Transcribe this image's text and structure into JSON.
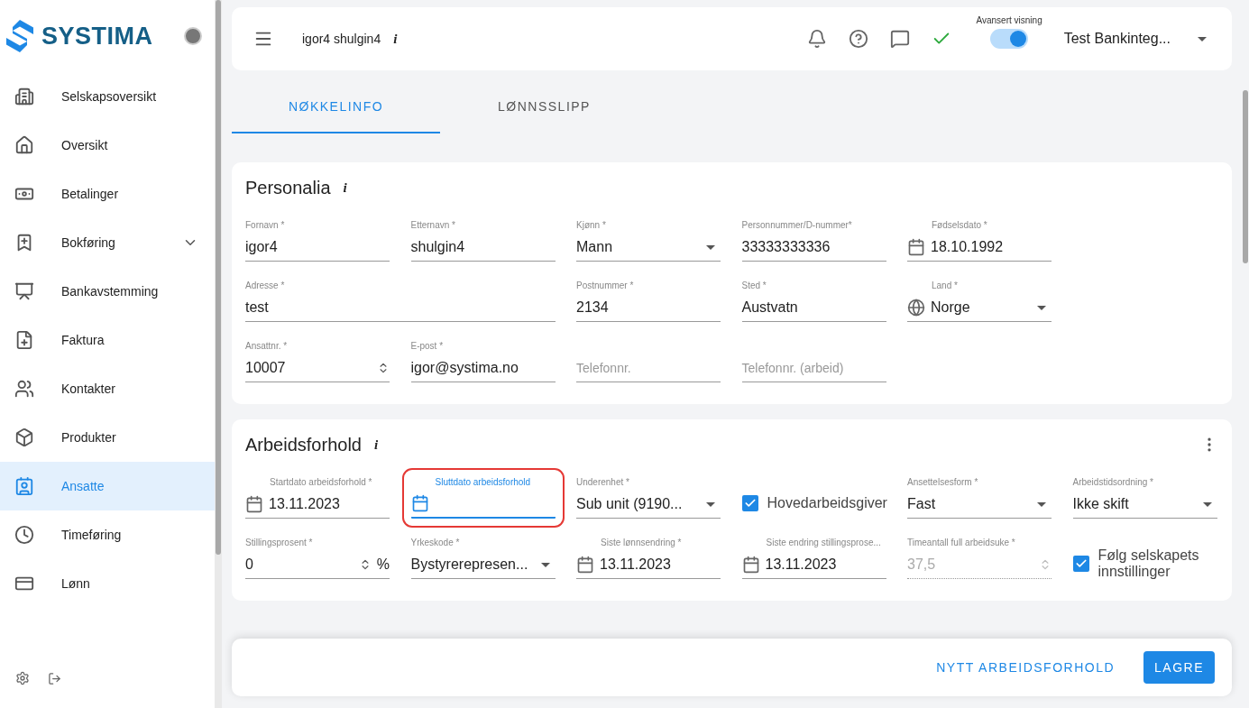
{
  "sidebar": {
    "logo": "SYSTIMA",
    "items": [
      {
        "label": "Selskapsoversikt",
        "selected": false
      },
      {
        "label": "Oversikt",
        "selected": false
      },
      {
        "label": "Betalinger",
        "selected": false
      },
      {
        "label": "Bokføring",
        "selected": false,
        "expandable": true
      },
      {
        "label": "Bankavstemming",
        "selected": false
      },
      {
        "label": "Faktura",
        "selected": false
      },
      {
        "label": "Kontakter",
        "selected": false
      },
      {
        "label": "Produkter",
        "selected": false
      },
      {
        "label": "Ansatte",
        "selected": true
      },
      {
        "label": "Timeføring",
        "selected": false
      },
      {
        "label": "Lønn",
        "selected": false
      }
    ]
  },
  "header": {
    "title": "igor4 shulgin4",
    "info": "i",
    "toggle": {
      "label": "Avansert visning",
      "on": true
    },
    "company": "Test Bankinteg..."
  },
  "tabs": [
    {
      "label": "NØKKELINFO",
      "selected": true
    },
    {
      "label": "LØNNSSLIPP",
      "selected": false
    }
  ],
  "sections": [
    {
      "title": "Personalia",
      "info": "i",
      "menu": false,
      "fields": [
        {
          "kind": "text",
          "label": "Fornavn *",
          "value": "igor4"
        },
        {
          "kind": "text",
          "label": "Etternavn *",
          "value": "shulgin4"
        },
        {
          "kind": "select",
          "label": "Kjønn *",
          "value": "Mann"
        },
        {
          "kind": "text",
          "label": "Personnummer/D-nummer*",
          "value": "33333333336"
        },
        {
          "kind": "date",
          "label": "Fødselsdato *",
          "value": "18.10.1992"
        },
        {
          "kind": "text",
          "label": "Adresse *",
          "value": "test",
          "wide": true
        },
        {
          "kind": "text",
          "label": "Postnummer *",
          "value": "2134"
        },
        {
          "kind": "text",
          "label": "Sted *",
          "value": "Austvatn"
        },
        {
          "kind": "country",
          "label": "Land *",
          "value": "Norge"
        },
        {
          "kind": "number",
          "label": "Ansattnr. *",
          "value": "10007"
        },
        {
          "kind": "text",
          "label": "E-post *",
          "value": "igor@systima.no"
        },
        {
          "kind": "text",
          "placeholder": "Telefonnr."
        },
        {
          "kind": "text",
          "placeholder": "Telefonnr. (arbeid)"
        }
      ]
    },
    {
      "title": "Arbeidsforhold",
      "info": "i",
      "menu": true,
      "fields": [
        {
          "kind": "date",
          "label": "Startdato arbeidsforhold *",
          "value": "13.11.2023"
        },
        {
          "kind": "date",
          "label": "Sluttdato arbeidsforhold",
          "focused": true,
          "highlighted": true
        },
        {
          "kind": "select",
          "label": "Underenhet *",
          "value": "Sub unit (9190..."
        },
        {
          "kind": "checkbox",
          "label": "Hovedarbeidsgiver",
          "checked": true
        },
        {
          "kind": "select",
          "label": "Ansettelsesform *",
          "value": "Fast"
        },
        {
          "kind": "select",
          "label": "Arbeidstidsordning *",
          "value": "Ikke skift"
        },
        {
          "kind": "number",
          "label": "Stillingsprosent *",
          "value": "0",
          "suffix": "%"
        },
        {
          "kind": "select",
          "label": "Yrkeskode *",
          "value": "Bystyrerepresen..."
        },
        {
          "kind": "date",
          "label": "Siste lønnsendring *",
          "value": "13.11.2023"
        },
        {
          "kind": "date",
          "label": "Siste endring stillingsprose...",
          "value": "13.11.2023"
        },
        {
          "kind": "number",
          "label": "Timeantall full arbeidsuke *",
          "value": "37,5",
          "disabled": true
        },
        {
          "kind": "checkbox",
          "label": "Følg selskapets innstillinger",
          "checked": true
        }
      ]
    }
  ],
  "footer": {
    "buttons": [
      {
        "kind": "text",
        "label": "NYTT ARBEIDSFORHOLD"
      },
      {
        "kind": "contained",
        "label": "LAGRE"
      }
    ]
  }
}
